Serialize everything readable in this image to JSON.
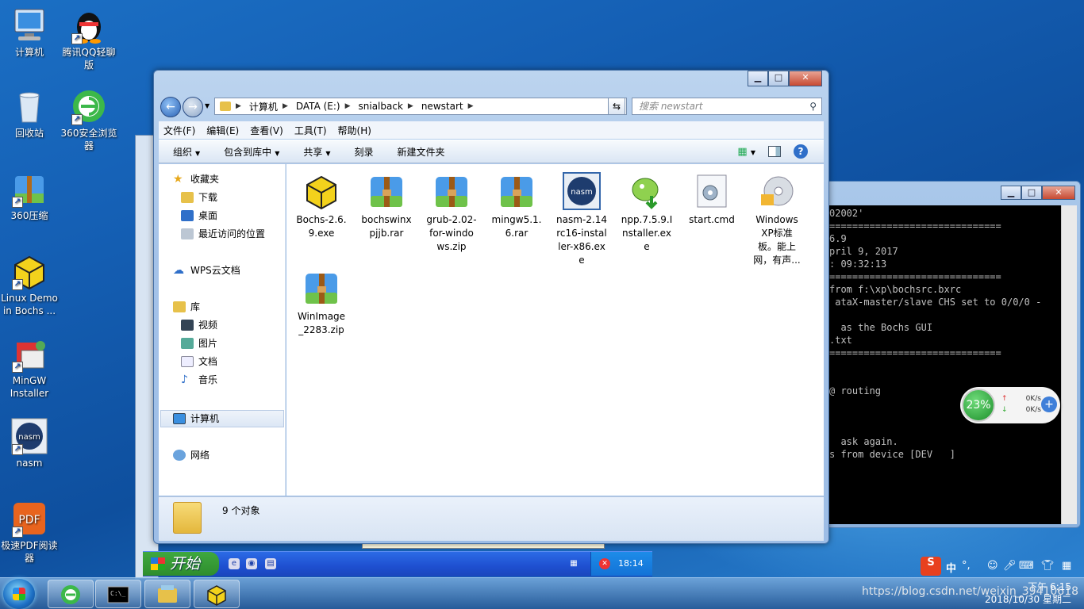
{
  "desktop": {
    "icons": [
      {
        "label": "计算机",
        "icon": "computer-icon"
      },
      {
        "label": "腾讯QQ轻聊版",
        "icon": "qq-penguin-icon"
      },
      {
        "label": "回收站",
        "icon": "recycle-bin-icon"
      },
      {
        "label": "360安全浏览器",
        "icon": "browser-360-icon"
      },
      {
        "label": "360压缩",
        "icon": "archive-360-icon"
      },
      {
        "label": "Linux Demo in Bochs ...",
        "icon": "bochs-box-icon"
      },
      {
        "label": "MinGW Installer",
        "icon": "installer-icon"
      },
      {
        "label": "nasm",
        "icon": "nasm-icon"
      },
      {
        "label": "极速PDF阅读器",
        "icon": "pdf-reader-icon"
      }
    ]
  },
  "explorer": {
    "address": {
      "segments": [
        "计算机",
        "DATA (E:)",
        "snialback",
        "newstart"
      ]
    },
    "search_placeholder": "搜索 newstart",
    "menu": [
      "文件(F)",
      "编辑(E)",
      "查看(V)",
      "工具(T)",
      "帮助(H)"
    ],
    "toolbar": {
      "organize": "组织",
      "include": "包含到库中",
      "share": "共享",
      "burn": "刻录",
      "new_folder": "新建文件夹"
    },
    "nav": {
      "favorites": "收藏夹",
      "downloads": "下载",
      "desktop": "桌面",
      "recent": "最近访问的位置",
      "wps": "WPS云文档",
      "libraries": "库",
      "videos": "视频",
      "pictures": "图片",
      "documents": "文档",
      "music": "音乐",
      "computer": "计算机",
      "network": "网络"
    },
    "files": [
      {
        "name": "Bochs-2.6.9.exe",
        "lines": [
          "Bochs-2.6.",
          "9.exe"
        ],
        "icon": "bochs-box-icon"
      },
      {
        "name": "bochswinxpjjb.rar",
        "lines": [
          "bochswinx",
          "pjjb.rar"
        ],
        "icon": "winrar-archive-icon"
      },
      {
        "name": "grub-2.02-for-windows.zip",
        "lines": [
          "grub-2.02-",
          "for-windo",
          "ws.zip"
        ],
        "icon": "winrar-archive-icon"
      },
      {
        "name": "mingw5.1.6.rar",
        "lines": [
          "mingw5.1.",
          "6.rar"
        ],
        "icon": "winrar-archive-icon"
      },
      {
        "name": "nasm-2.14rc16-installer-x86.exe",
        "lines": [
          "nasm-2.14",
          "rc16-instal",
          "ler-x86.ex",
          "e"
        ],
        "icon": "nasm-icon"
      },
      {
        "name": "npp.7.5.9.Installer.exe",
        "lines": [
          "npp.7.5.9.I",
          "nstaller.ex",
          "e"
        ],
        "icon": "notepad-plus-icon"
      },
      {
        "name": "start.cmd",
        "lines": [
          "start.cmd"
        ],
        "icon": "cmd-script-icon"
      },
      {
        "name": "Windows XP标准板。能上网，有声...",
        "lines": [
          "Windows",
          "XP标准",
          "板。能上",
          "网，有声..."
        ],
        "icon": "xp-cd-icon"
      },
      {
        "name": "WinImage_2283.zip",
        "lines": [
          "WinImage",
          "_2283.zip"
        ],
        "icon": "winrar-archive-icon"
      }
    ],
    "status_count": "9 个对象"
  },
  "console": {
    "lines": [
      "02002'",
      "==============================",
      "6.9",
      "pril 9, 2017",
      ": 09:32:13",
      "==============================",
      "from f:\\xp\\bochsrc.bxrc",
      " ataX-master/slave CHS set to 0/0/0 -",
      "",
      "  as the Bochs GUI",
      ".txt",
      "==============================",
      "",
      "",
      "@ routing",
      "",
      "",
      "",
      "  ask again.",
      "s from device [DEV   ]"
    ]
  },
  "speed_widget": {
    "percent": "23%",
    "up": "0K/s",
    "down": "0K/s"
  },
  "xp_taskbar": {
    "start": "开始",
    "clock": "18:14"
  },
  "win_taskbar": {
    "clock_time": "下午 6:15",
    "clock_date": "2018/10/30 星期二",
    "watermark": "https://blog.csdn.net/weixin_39410618",
    "ime": "中"
  },
  "colors": {
    "accent": "#1e5fc0",
    "console_bg": "#000000"
  }
}
